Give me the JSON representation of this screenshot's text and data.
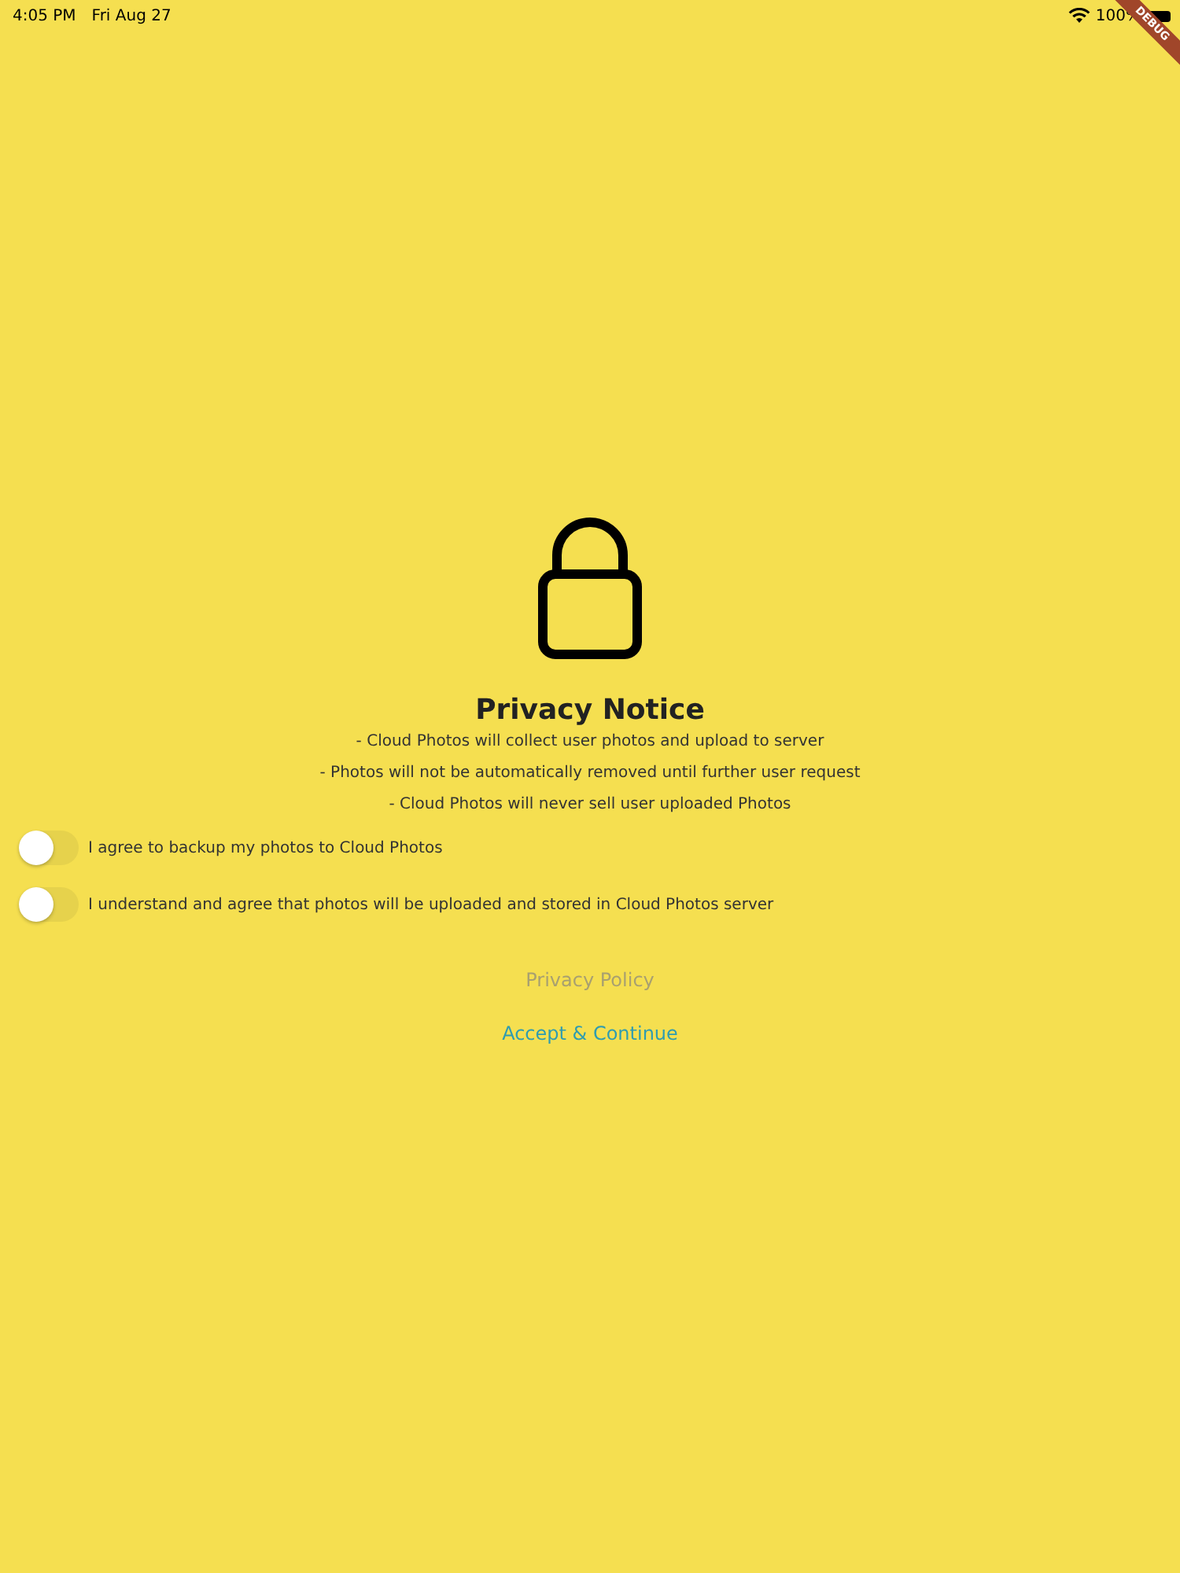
{
  "status_bar": {
    "time": "4:05 PM",
    "date": "Fri Aug 27",
    "battery": "100%"
  },
  "debug_banner": "DEBUG",
  "title": "Privacy Notice",
  "notes": [
    "- Cloud Photos will collect user photos and upload to server",
    "- Photos will not be automatically removed until further user request",
    "- Cloud Photos will never sell user uploaded Photos"
  ],
  "consents": [
    {
      "label": "I agree to backup my photos to Cloud Photos",
      "on": false
    },
    {
      "label": "I understand and agree that photos will be uploaded and stored in Cloud Photos server",
      "on": false
    }
  ],
  "buttons": [
    {
      "label": "Privacy Policy",
      "disabled": true
    },
    {
      "label": "Accept & Continue",
      "disabled": false
    }
  ]
}
